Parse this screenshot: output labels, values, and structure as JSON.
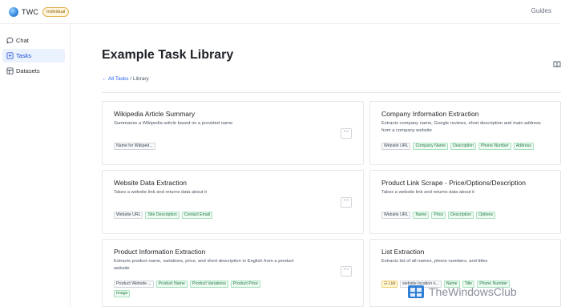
{
  "header": {
    "brand": "TWC",
    "plan_badge": "Individual",
    "guides": "Guides"
  },
  "sidebar": {
    "items": [
      {
        "label": "Chat",
        "icon": "chat-bubble-icon",
        "active": false
      },
      {
        "label": "Tasks",
        "icon": "tasks-icon",
        "active": true
      },
      {
        "label": "Datasets",
        "icon": "table-icon",
        "active": false
      }
    ]
  },
  "main": {
    "title": "Example Task Library",
    "breadcrumb": {
      "back_link": "All Tasks",
      "separator": " / ",
      "current": "Library"
    },
    "more_label": "⋯"
  },
  "cards": [
    {
      "title": "Wikipedia Article Summary",
      "desc": "Summarize a Wikipedia article based on a provided name",
      "inputs": [
        "Name for Wikiped..."
      ],
      "outputs": []
    },
    {
      "title": "Company Information Extraction",
      "desc": "Extracts company name, Google reviews, short description and main address from a company website",
      "inputs": [
        "Website URL"
      ],
      "outputs": [
        "Company Name",
        "Description",
        "Phone Number",
        "Address"
      ]
    },
    {
      "title": "Website Data Extraction",
      "desc": "Takes a website link and returns data about it",
      "inputs": [
        "Website URL"
      ],
      "outputs": [
        "Site Description",
        "Contact Email"
      ]
    },
    {
      "title": "Product Link Scrape - Price/Options/Description",
      "desc": "Takes a website link and returns data about it",
      "inputs": [
        "Website URL"
      ],
      "outputs": [
        "Name",
        "Price",
        "Description",
        "Options"
      ]
    },
    {
      "title": "Product Information Extraction",
      "desc": "Extracts product name, variations, price, and short description in English from a product website",
      "inputs": [
        "Product Website ..."
      ],
      "outputs": [
        "Product Name",
        "Product Variations",
        "Product Price",
        "Image"
      ]
    },
    {
      "title": "List Extraction",
      "desc": "Extracts list of all names, phone numbers, and titles",
      "list_tag": "List",
      "inputs": [
        "website location o..."
      ],
      "outputs": [
        "Name",
        "Title",
        "Phone Number"
      ]
    }
  ],
  "watermark": {
    "text": "TheWindowsClub"
  },
  "colors": {
    "accent": "#2563eb",
    "active_bg": "#eaf2fd",
    "output_tag_bg": "#eefaf2",
    "output_tag_text": "#1f7a43",
    "badge_bg": "#fff6df"
  }
}
